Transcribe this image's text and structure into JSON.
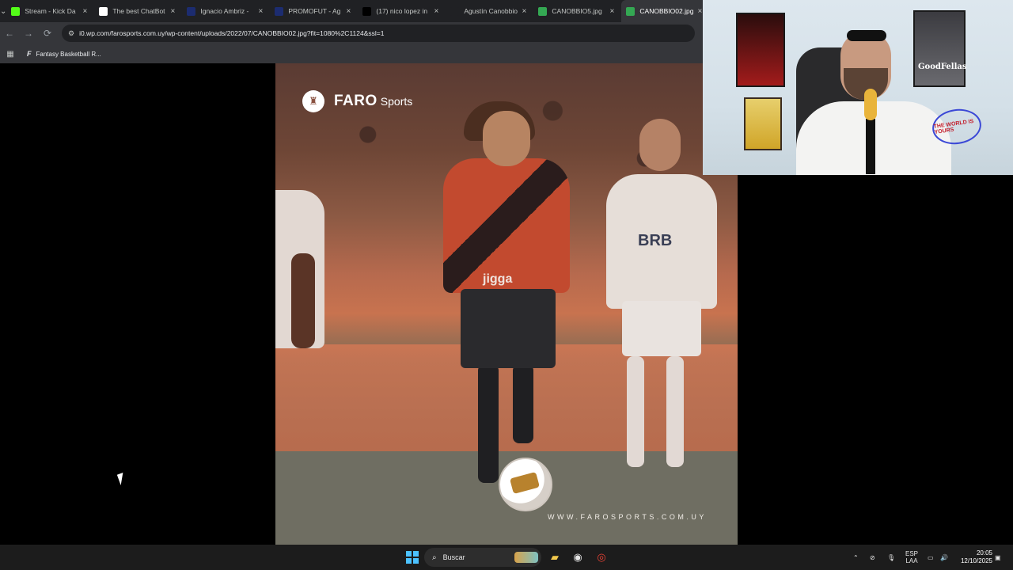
{
  "browser": {
    "tabs": [
      {
        "title": "Stream - Kick Da",
        "icon": "kick-icon",
        "color": "#53fc18"
      },
      {
        "title": "The best ChatBot",
        "icon": "chatbot-icon",
        "color": "#ffffff"
      },
      {
        "title": "Ignacio Ambriz -",
        "icon": "site-icon",
        "color": "#1c2c70"
      },
      {
        "title": "PROMOFUT - Ag",
        "icon": "site-icon",
        "color": "#1c2c70"
      },
      {
        "title": "(17) nico lopez in",
        "icon": "x-icon",
        "color": "#000000"
      },
      {
        "title": "Agustín Canobbio",
        "icon": "blank-icon",
        "color": "#202124"
      },
      {
        "title": "CANOBBIO5.jpg",
        "icon": "image-icon",
        "color": "#34a853"
      },
      {
        "title": "CANOBBIO02.jpg",
        "icon": "image-icon",
        "color": "#34a853"
      }
    ],
    "url": "i0.wp.com/farosports.com.uy/wp-content/uploads/2022/07/CANOBBIO02.jpg?fit=1080%2C1124&ssl=1",
    "bookmark": "Fantasy Basketball R..."
  },
  "image": {
    "brand": "FARO",
    "brand_sub": "Sports",
    "url_watermark": "WWW.FAROSPORTS.COM.UY",
    "jersey_text": "jigga",
    "sponsor": "BRB"
  },
  "webcam": {
    "poster_title": "GoodFellas",
    "neon_text": "THE WORLD IS YOURS"
  },
  "taskbar": {
    "search_placeholder": "Buscar",
    "lang": "ESP",
    "lang_sub": "LAA",
    "time": "20:05",
    "date": "12/10/2025"
  }
}
